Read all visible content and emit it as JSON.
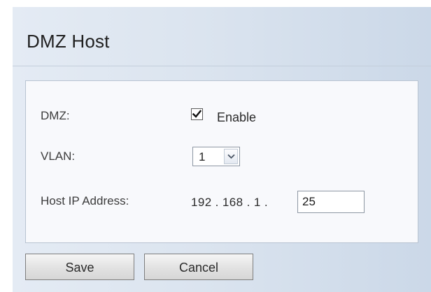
{
  "page": {
    "title": "DMZ Host"
  },
  "form": {
    "dmz": {
      "label": "DMZ:",
      "checkbox_checked": true,
      "checkbox_text": "Enable"
    },
    "vlan": {
      "label": "VLAN:",
      "selected_value": "1"
    },
    "host_ip": {
      "label": "Host IP Address:",
      "prefix": "192 . 168 . 1 .",
      "last_octet_value": "25"
    }
  },
  "buttons": {
    "save_label": "Save",
    "cancel_label": "Cancel"
  },
  "icons": {
    "checkbox": "checkmark-icon",
    "select_arrow": "chevron-down-icon"
  },
  "colors": {
    "background": "#dbe4ef",
    "panel": "#f8f9fc",
    "panel_border": "#b8c3d1"
  }
}
